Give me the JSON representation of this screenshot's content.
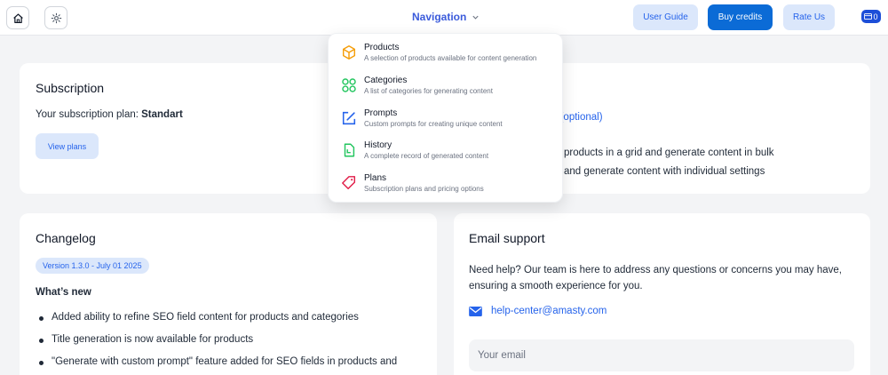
{
  "topbar": {
    "nav_label": "Navigation",
    "user_guide": "User Guide",
    "buy_credits": "Buy credits",
    "rate_us": "Rate Us",
    "credits_count": "0"
  },
  "navigation_menu": {
    "items": [
      {
        "label": "Products",
        "description": "A selection of products available for content generation",
        "icon": "cube-icon",
        "color": "#f59e0b"
      },
      {
        "label": "Categories",
        "description": "A list of categories for generating content",
        "icon": "categories-icon",
        "color": "#22c55e"
      },
      {
        "label": "Prompts",
        "description": "Custom prompts for creating unique content",
        "icon": "edit-icon",
        "color": "#2563eb"
      },
      {
        "label": "History",
        "description": "A complete record of generated content",
        "icon": "history-icon",
        "color": "#22c55e"
      },
      {
        "label": "Plans",
        "description": "Subscription plans and pricing options",
        "icon": "tag-icon",
        "color": "#e11d48"
      }
    ]
  },
  "subscription": {
    "title": "Subscription",
    "plan_prefix": "Your subscription plan:",
    "plan_name": "Standart",
    "view_plans": "View plans"
  },
  "partial_card": {
    "link_fragment": "p (optional)",
    "line1": "products in a grid and generate content in bulk",
    "line2": "and generate content with individual settings"
  },
  "changelog": {
    "title": "Changelog",
    "version": "Version 1.3.0 - July 01 2025",
    "whats_new": "What’s new",
    "items": [
      "Added ability to refine SEO field content for products and categories",
      "Title generation is now available for products",
      "\"Generate with custom prompt\" feature added for SEO fields in products and"
    ]
  },
  "email_support": {
    "title": "Email support",
    "description": "Need help? Our team is here to address any questions or concerns you may have, ensuring a smooth experience for you.",
    "email": "help-center@amasty.com",
    "email_placeholder": "Your email"
  },
  "colors": {
    "accent": "#2563eb",
    "primary_button": "#0b6bd6",
    "soft_button": "#dbe7fb",
    "background": "#f3f4f6"
  }
}
